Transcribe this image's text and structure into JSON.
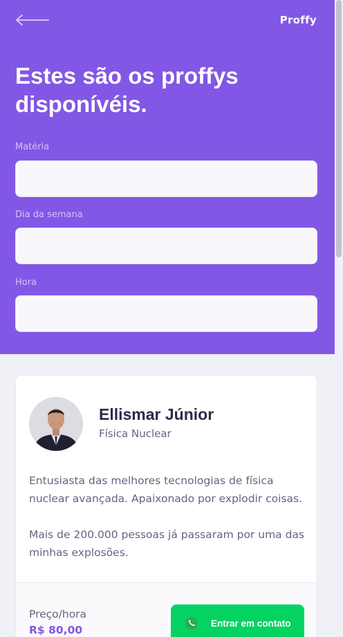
{
  "header": {
    "logo": "Proffy",
    "title": "Estes são os proffys disponívéis."
  },
  "filters": [
    {
      "label": "Matéria",
      "value": ""
    },
    {
      "label": "Dia da semana",
      "value": ""
    },
    {
      "label": "Hora",
      "value": ""
    }
  ],
  "teacher": {
    "name": "Ellismar Júnior",
    "subject": "Física Nuclear",
    "bio_1": "Entusiasta das melhores tecnologias de física nuclear avançada. Apaixonado por explodir coisas.",
    "bio_2": "Mais de 200.000 pessoas já passaram por uma das minhas explosões.",
    "price_label": "Preço/hora",
    "price_value": "R$ 80,00",
    "contact_label": "Entrar em contato"
  },
  "icons": {
    "back": "arrow-left-icon",
    "contact": "whatsapp-icon"
  },
  "colors": {
    "primary": "#8257E5",
    "success": "#04D361",
    "background": "#F0F0F7",
    "title_text": "#32264D",
    "body_text": "#6A6180"
  }
}
